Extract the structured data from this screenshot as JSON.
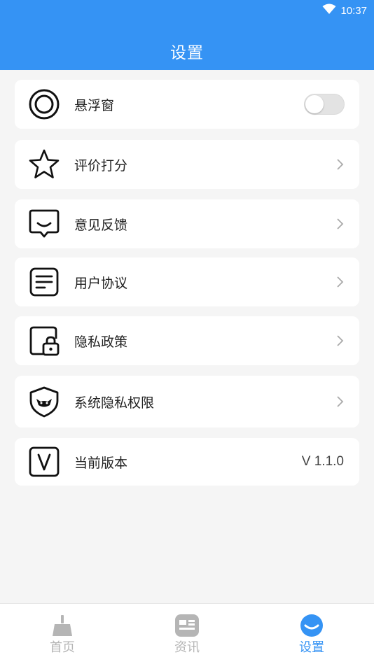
{
  "status_bar": {
    "time": "10:37",
    "icons": [
      "wifi-icon"
    ]
  },
  "header": {
    "title": "设置"
  },
  "settings": [
    {
      "key": "float",
      "icon": "floating-window-icon",
      "label": "悬浮窗",
      "control": "toggle",
      "enabled": false
    },
    {
      "key": "rate",
      "icon": "star-icon",
      "label": "评价打分",
      "control": "chevron"
    },
    {
      "key": "feedback",
      "icon": "feedback-icon",
      "label": "意见反馈",
      "control": "chevron"
    },
    {
      "key": "agreement",
      "icon": "document-icon",
      "label": "用户协议",
      "control": "chevron"
    },
    {
      "key": "privacy",
      "icon": "privacy-lock-icon",
      "label": "隐私政策",
      "control": "chevron"
    },
    {
      "key": "permissions",
      "icon": "shield-icon",
      "label": "系统隐私权限",
      "control": "chevron"
    },
    {
      "key": "version",
      "icon": "version-icon",
      "label": "当前版本",
      "control": "text",
      "value": "V 1.1.0"
    }
  ],
  "tabbar": {
    "tabs": [
      {
        "label": "首页",
        "icon": "broom-icon",
        "active": false
      },
      {
        "label": "资讯",
        "icon": "news-icon",
        "active": false
      },
      {
        "label": "设置",
        "icon": "settings-face-icon",
        "active": true
      }
    ]
  },
  "colors": {
    "primary": "#3593f4",
    "background": "#f5f5f5",
    "inactive": "#b5b5b5"
  }
}
